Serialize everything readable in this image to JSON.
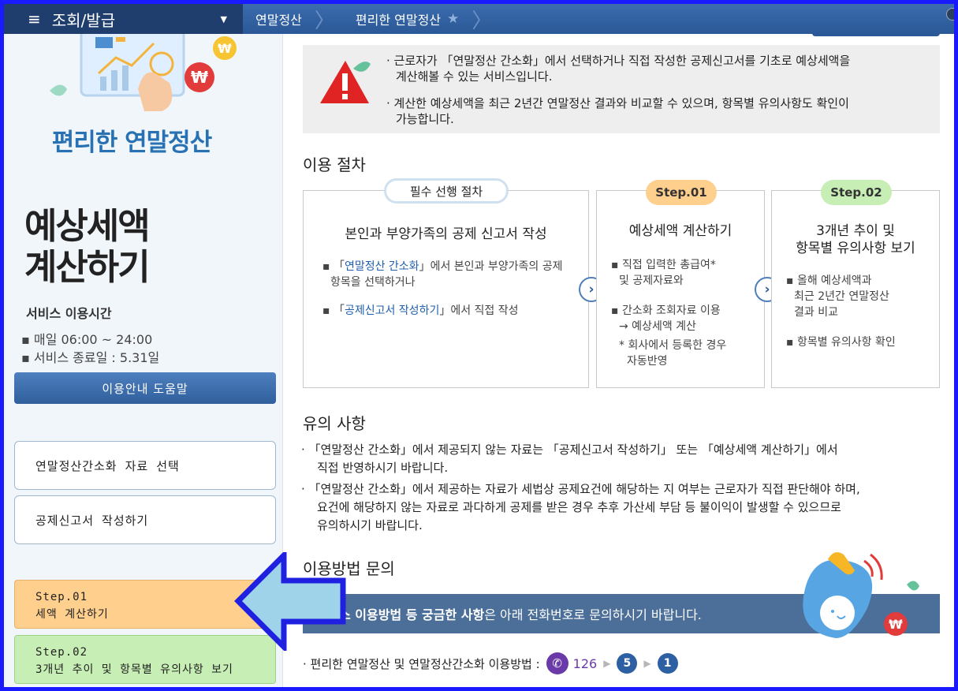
{
  "topbar": {
    "menu_label": "조회/발급",
    "crumbs": [
      "연말정산",
      "편리한 연말정산"
    ]
  },
  "left": {
    "brand": "편리한 연말정산",
    "page_title_line1": "예상세액",
    "page_title_line2": "계산하기",
    "service_time_title": "서비스 이용시간",
    "service_time_lines": [
      "▪ 매일 06:00 ~ 24:00",
      "▪ 서비스 종료일 : 5.31일"
    ],
    "help_button": "이용안내 도움말",
    "nav": {
      "select_data": "연말정산간소화 자료 선택",
      "write_form": "공제신고서 작성하기",
      "step1_label": "Step.01",
      "step1_text": "세액 계산하기",
      "step2_label": "Step.02",
      "step2_text": "3개년 추이 및 항목별 유의사항 보기"
    }
  },
  "notice": {
    "line1a": "· 근로자가 「연말정산 간소화」에서 선택하거나 직접 작성한 공제신고서를 기초로 예상세액을",
    "line1b": "계산해볼 수 있는 서비스입니다.",
    "line2a": "· 계산한 예상세액을 최근 2년간 연말정산 결과와 비교할 수 있으며, 항목별 유의사항도 확인이",
    "line2b": "가능합니다."
  },
  "procedure": {
    "title": "이용 절차",
    "pre": {
      "pill": "필수 선행 절차",
      "title": "본인과 부양가족의 공제 신고서 작성",
      "item1_prefix": "▪ 「",
      "item1_quote": "연말정산 간소화",
      "item1_rest": "」에서 본인과 부양가족의 공제",
      "item1_line2": "항목을 선택하거나",
      "item2_prefix": "▪ 「",
      "item2_quote": "공제신고서 작성하기",
      "item2_rest": "」에서 직접 작성"
    },
    "step1": {
      "pill": "Step.01",
      "title": "예상세액 계산하기",
      "item1a": "▪ 직접 입력한 총급여*",
      "item1b": "및 공제자료와",
      "item2a": "▪ 간소화 조회자료 이용",
      "item2b": "→ 예상세액 계산",
      "item3a": "* 회사에서 등록한 경우",
      "item3b": "자동반영"
    },
    "step2": {
      "pill": "Step.02",
      "title_line1": "3개년 추이 및",
      "title_line2": "항목별 유의사항 보기",
      "item1a": "▪ 올해 예상세액과",
      "item1b": "최근 2년간 연말정산",
      "item1c": "결과 비교",
      "item2": "▪ 항목별 유의사항 확인"
    },
    "arrow": "›"
  },
  "cautions": {
    "title": "유의 사항",
    "c1a": "· 「연말정산 간소화」에서 제공되지 않는 자료는 「공제신고서 작성하기」 또는 「예상세액 계산하기」에서",
    "c1b": "직접 반영하시기 바랍니다.",
    "c2a": "· 「연말정산 간소화」에서 제공하는 자료가 세법상 공제요건에 해당하는 지 여부는 근로자가 직접 판단해야 하며,",
    "c2b": "요건에 해당하지 않는 자료로 과다하게 공제를 받은 경우 추후 가산세 부담 등 불이익이 발생할 수 있으므로",
    "c2c": "유의하시기 바랍니다."
  },
  "inquiry": {
    "title": "이용방법 문의",
    "bar_bold": "스 이용방법 등 궁금한 사항",
    "bar_rest": "은 아래 전화번호로 문의하시기 바랍니다.",
    "phone_label": "· 편리한 연말정산 및 연말정산간소화 이용방법 :",
    "phone_number": "126",
    "press1": "5",
    "press2": "1"
  },
  "colors": {
    "accent": "#2b5896",
    "orange": "#ffcf8e",
    "green": "#c7eeb4",
    "frame": "#1a1aff",
    "annotation": "#2020e0"
  }
}
